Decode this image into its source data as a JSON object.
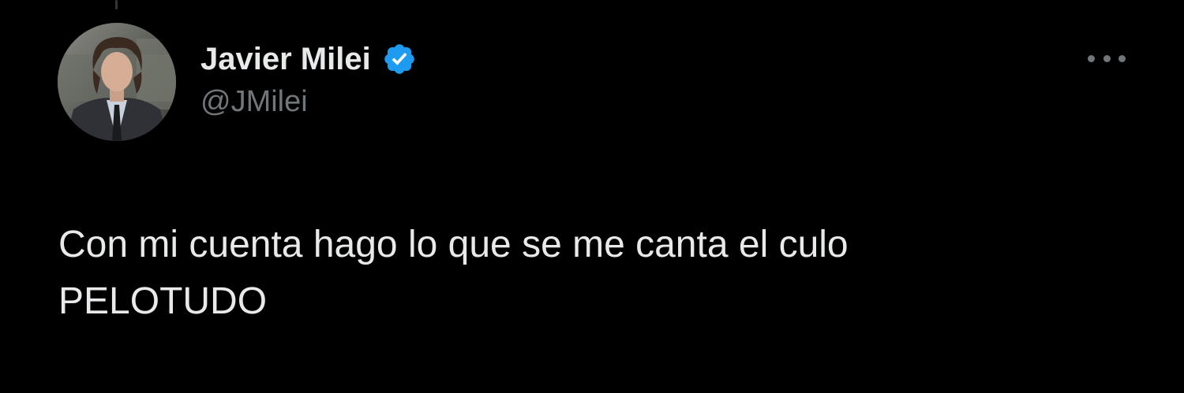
{
  "tweet": {
    "author": {
      "name": "Javier Milei",
      "handle": "@JMilei",
      "verified": true,
      "avatar_icon": "profile-photo"
    },
    "text_lines": [
      "Con mi cuenta hago lo que se me canta el culo",
      "PELOTUDO"
    ],
    "more_icon": "more-options-icon"
  },
  "colors": {
    "background": "#000000",
    "text_primary": "#e7e9ea",
    "text_secondary": "#71767b",
    "verified_blue": "#1d9bf0"
  }
}
